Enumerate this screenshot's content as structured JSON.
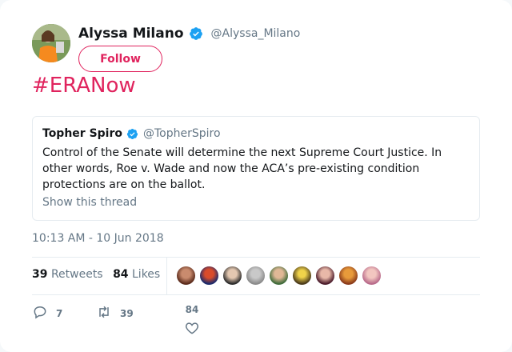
{
  "tweet": {
    "author": {
      "display_name": "Alyssa Milano",
      "handle": "@Alyssa_Milano",
      "verified_icon": "verified-badge-icon"
    },
    "follow_label": "Follow",
    "text": "#ERANow",
    "timestamp": "10:13 AM - 10 Jun 2018"
  },
  "quoted": {
    "display_name": "Topher Spiro",
    "handle": "@TopherSpiro",
    "text": "Control of the Senate will determine the next Supreme Court Justice. In other words, Roe v. Wade and now the ACA’s pre-existing condition protections are on the ballot.",
    "show_thread": "Show this thread"
  },
  "stats": {
    "retweets_count": "39",
    "retweets_label": "Retweets",
    "likes_count": "84",
    "likes_label": "Likes"
  },
  "actions": {
    "reply_count": "7",
    "retweet_count": "39",
    "like_count": "84"
  },
  "colors": {
    "accent": "#e0245e",
    "verified": "#1da1f2",
    "secondary_text": "#657786"
  }
}
